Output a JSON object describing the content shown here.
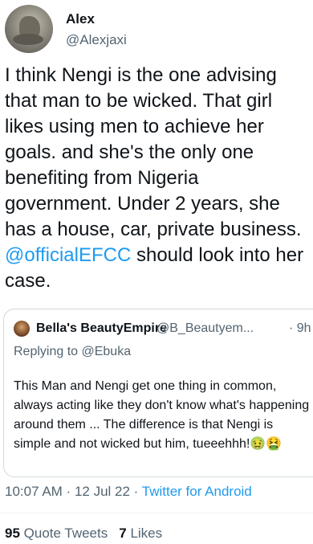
{
  "author": {
    "name": "Alex",
    "handle": "@Alexjaxi"
  },
  "tweet": {
    "text_before": "I think Nengi is the  one advising that man to be wicked. That girl likes using men to achieve her goals. and she's the only one benefiting from Nigeria government. Under 2 years, she has a house, car, private business. ",
    "mention": "@officialEFCC",
    "text_after": " should look into her case."
  },
  "quoted_tweet": {
    "name": "Bella's BeautyEmpire",
    "handle": "@B_Beautyem...",
    "time": "· 9h",
    "replying_to": "Replying to @Ebuka",
    "text": "This Man and Nengi get one thing in common, always acting like they don't know what's happening around them ... The difference is that Nengi is simple and not wicked but him, tueeehhh!🤢🤮"
  },
  "meta": {
    "time": "10:07 AM",
    "separator": " · ",
    "date": "12 Jul 22",
    "source": "Twitter for Android"
  },
  "stats": {
    "quote_count": "95",
    "quote_label": "Quote Tweets",
    "likes_count": "7",
    "likes_label": "Likes"
  }
}
